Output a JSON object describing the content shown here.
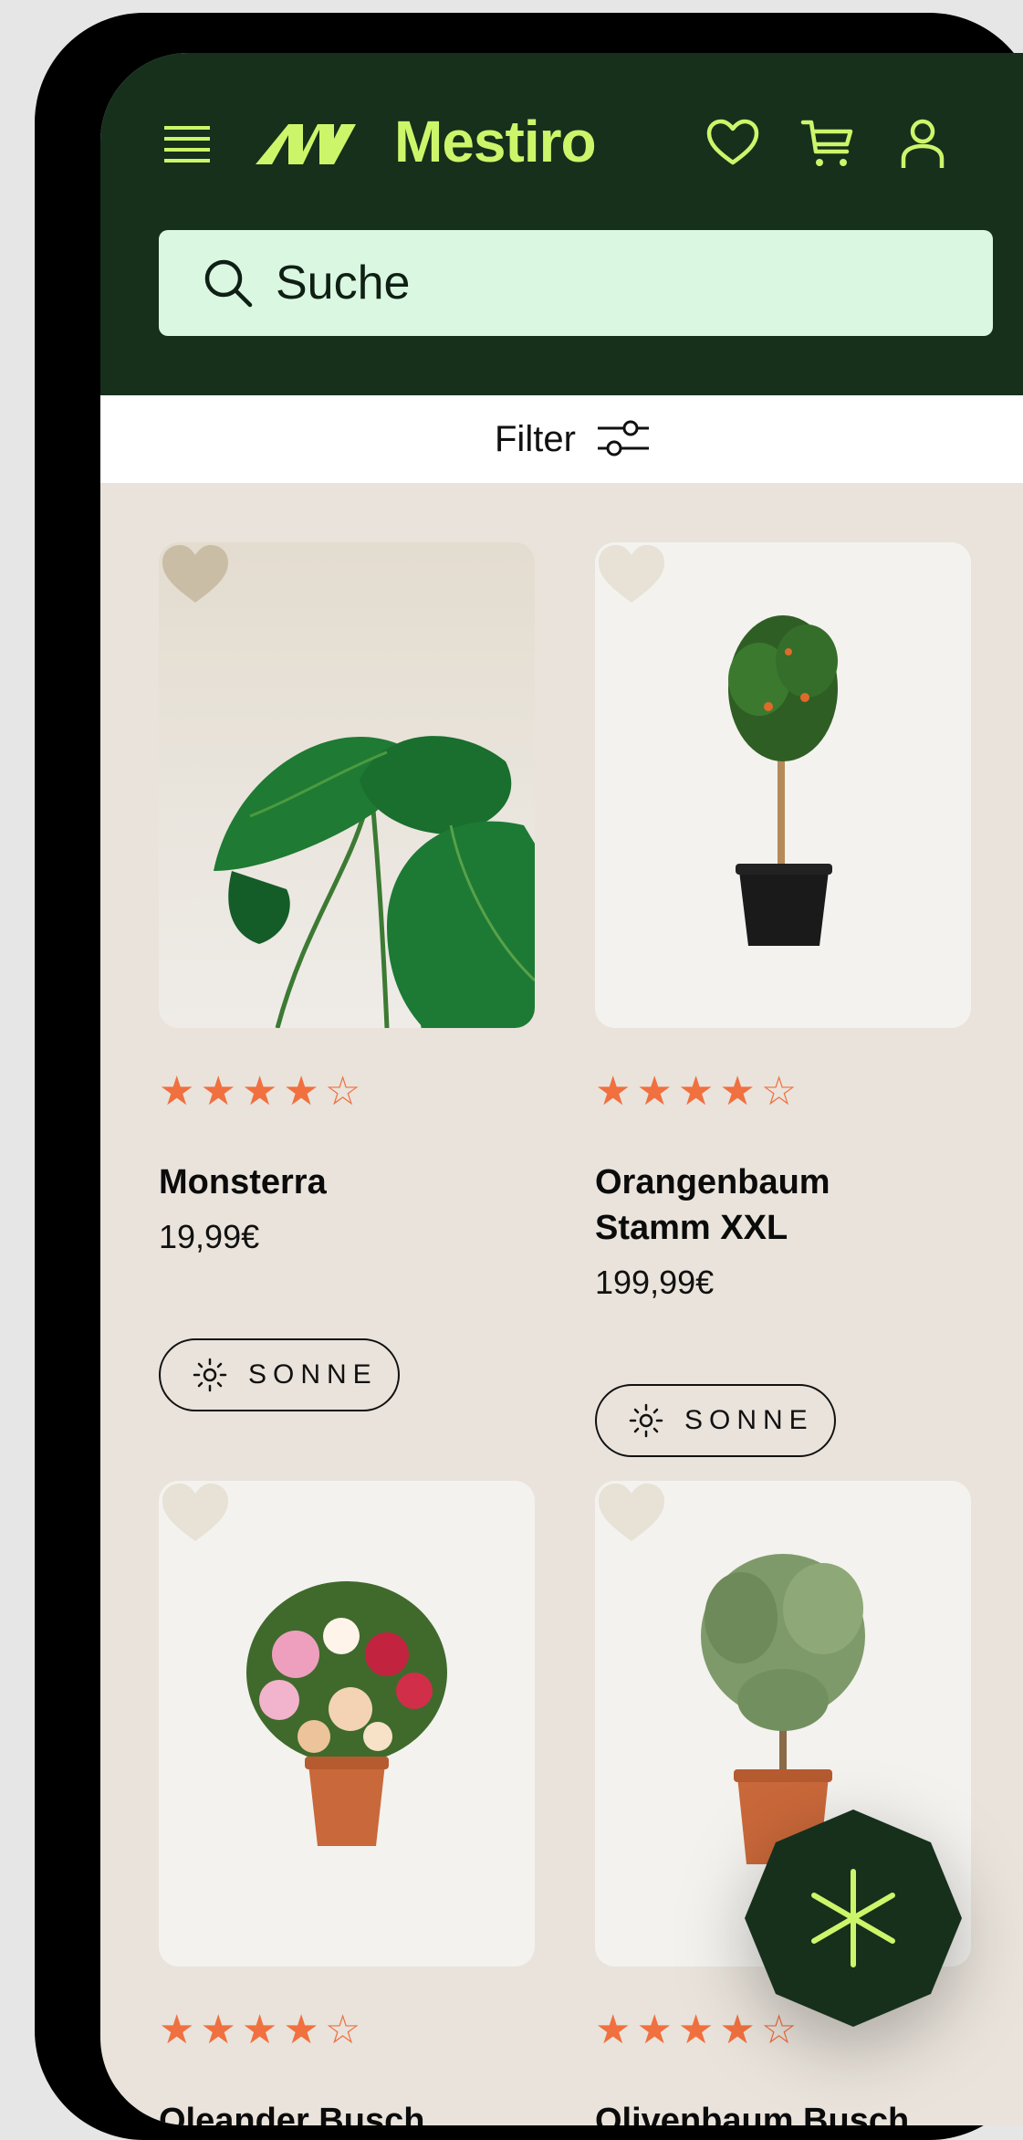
{
  "brand": {
    "name": "Mestiro",
    "accent_color": "#cdf56a",
    "header_color": "#16301c"
  },
  "header": {
    "menu_icon": "hamburger-menu-icon",
    "icons": [
      "heart-icon",
      "cart-icon",
      "user-icon"
    ]
  },
  "search": {
    "placeholder": "Suche",
    "icon": "search-icon"
  },
  "filter": {
    "label": "Filter",
    "icon": "sliders-icon"
  },
  "products": [
    {
      "name": "Monsterra",
      "price": "19,99€",
      "rating": 4,
      "rating_max": 5,
      "tag": "SONNE",
      "tag_icon": "sun-icon"
    },
    {
      "name": "Orangenbaum Stamm XXL",
      "price": "199,99€",
      "rating": 4,
      "rating_max": 5,
      "tag": "SONNE",
      "tag_icon": "sun-icon"
    },
    {
      "name": "Oleander Busch",
      "rating": 4,
      "rating_max": 5
    },
    {
      "name": "Olivenbaum Busch",
      "rating": 4,
      "rating_max": 5
    }
  ],
  "fab": {
    "icon": "asterisk-icon",
    "color": "#16301c"
  },
  "star_color": "#f0703f"
}
